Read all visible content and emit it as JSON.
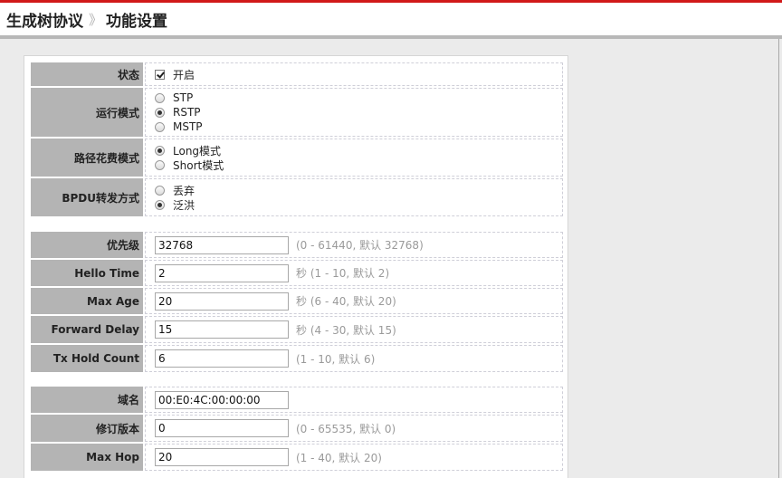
{
  "header": {
    "title": "生成树协议",
    "separator": "》",
    "subtitle": "功能设置"
  },
  "colors": {
    "accent": "#d11919",
    "label_bg": "#b4b4b4",
    "hint_text": "#9a9a9a"
  },
  "status": {
    "label": "状态",
    "checkbox_label": "开启",
    "checked": true
  },
  "run_mode": {
    "label": "运行模式",
    "options": [
      {
        "label": "STP",
        "selected": false
      },
      {
        "label": "RSTP",
        "selected": true
      },
      {
        "label": "MSTP",
        "selected": false
      }
    ]
  },
  "path_cost": {
    "label": "路径花费模式",
    "options": [
      {
        "label": "Long模式",
        "selected": true
      },
      {
        "label": "Short模式",
        "selected": false
      }
    ]
  },
  "bpdu": {
    "label": "BPDU转发方式",
    "options": [
      {
        "label": "丢弃",
        "selected": false
      },
      {
        "label": "泛洪",
        "selected": true
      }
    ]
  },
  "priority": {
    "label": "优先级",
    "value": "32768",
    "hint": "(0 - 61440, 默认 32768)"
  },
  "hello_time": {
    "label": "Hello Time",
    "value": "2",
    "hint": "秒 (1 - 10, 默认 2)"
  },
  "max_age": {
    "label": "Max Age",
    "value": "20",
    "hint": "秒 (6 - 40, 默认 20)"
  },
  "forward_delay": {
    "label": "Forward Delay",
    "value": "15",
    "hint": "秒 (4 - 30, 默认 15)"
  },
  "tx_hold_count": {
    "label": "Tx Hold Count",
    "value": "6",
    "hint": "(1 - 10, 默认 6)"
  },
  "region_name": {
    "label": "域名",
    "value": "00:E0:4C:00:00:00"
  },
  "revision": {
    "label": "修订版本",
    "value": "0",
    "hint": "(0 - 65535, 默认 0)"
  },
  "max_hop": {
    "label": "Max Hop",
    "value": "20",
    "hint": "(1 - 40, 默认 20)"
  }
}
